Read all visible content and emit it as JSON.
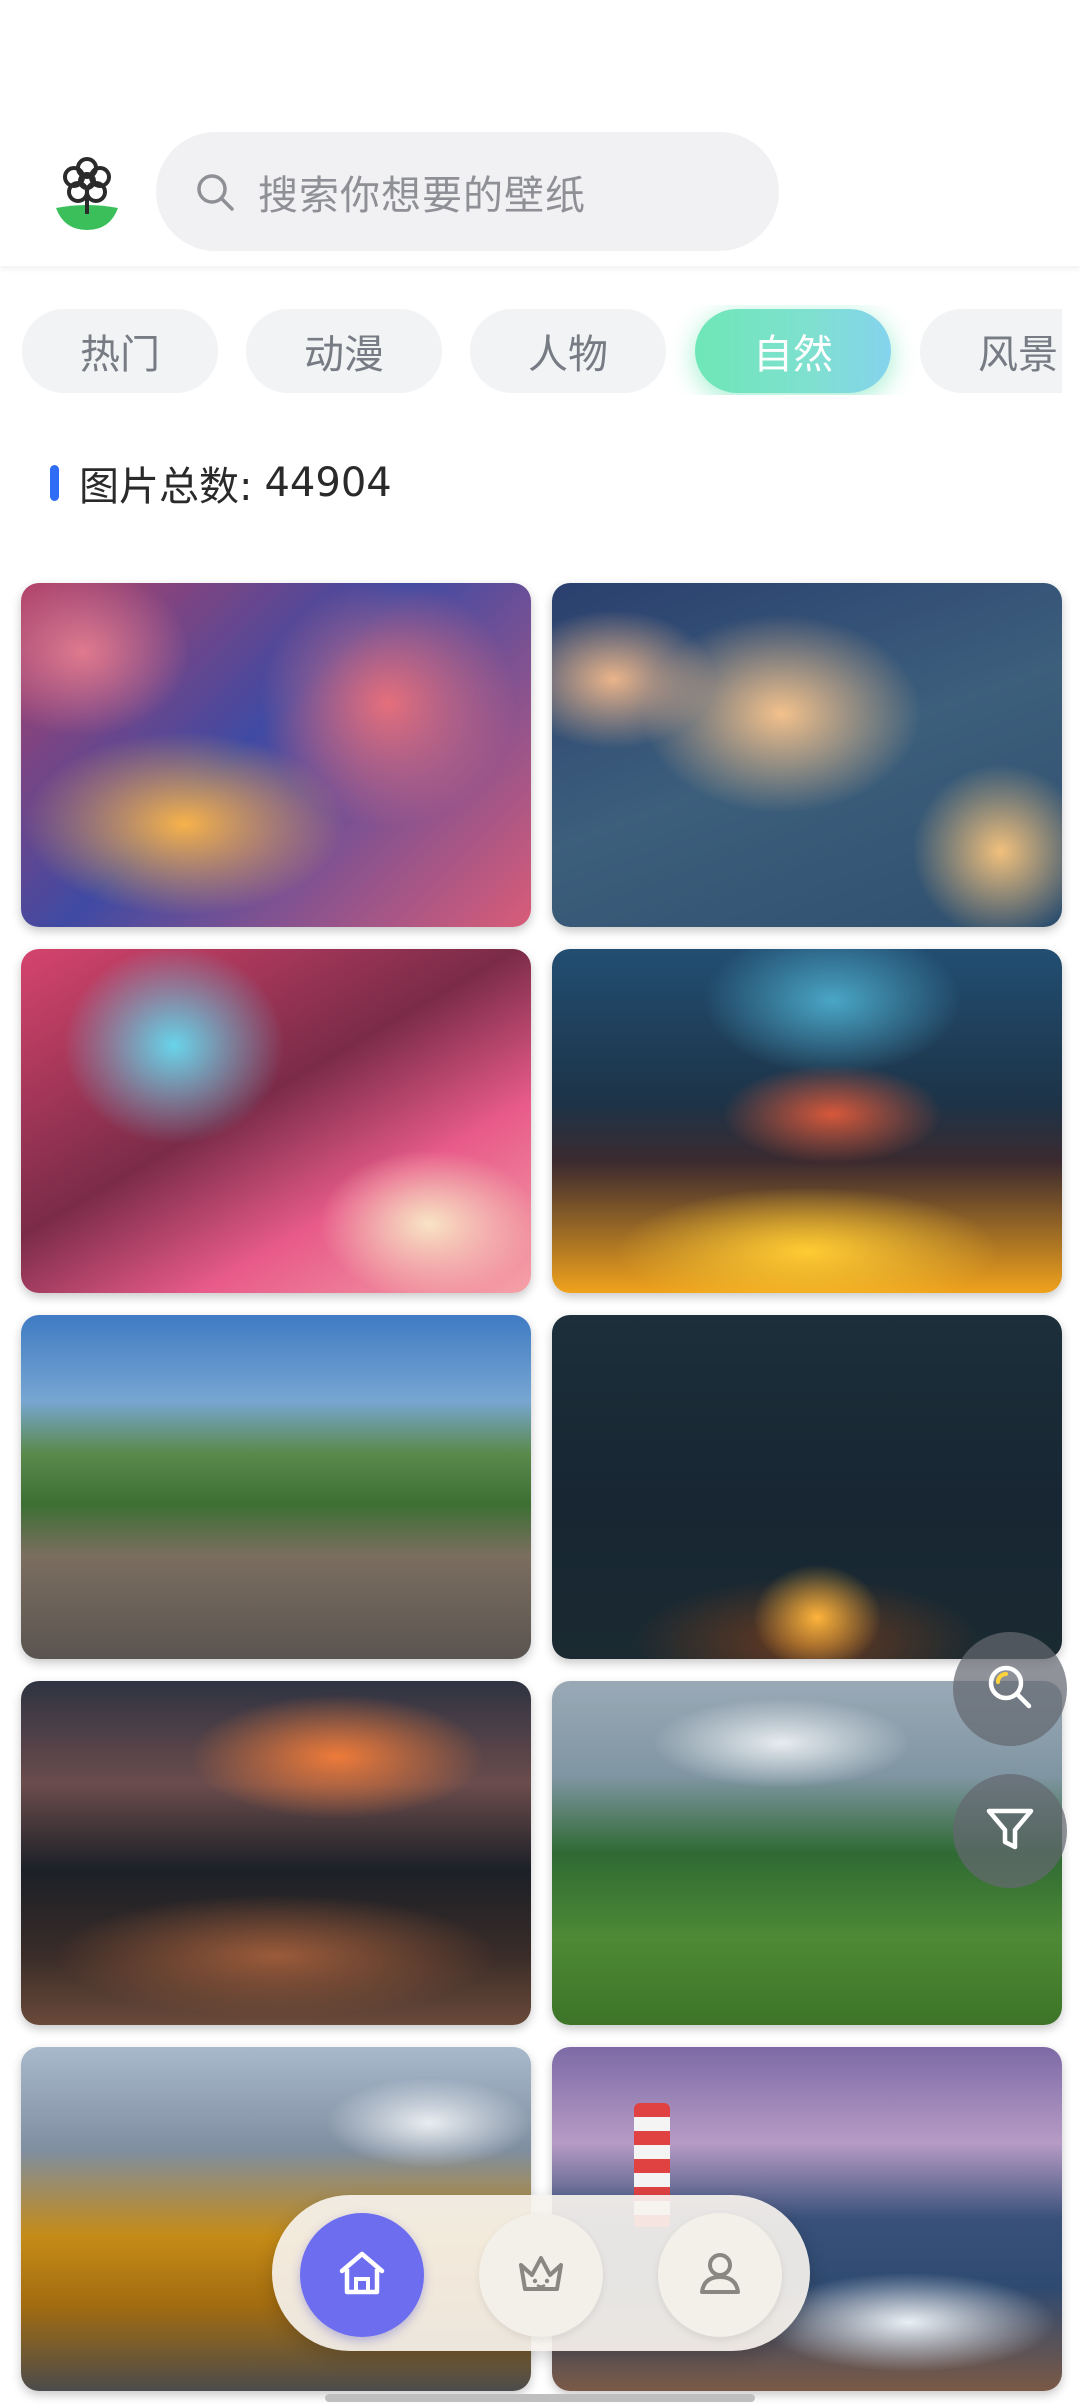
{
  "search": {
    "placeholder": "搜索你想要的壁纸"
  },
  "tabs": [
    {
      "label": "热门"
    },
    {
      "label": "动漫"
    },
    {
      "label": "人物"
    },
    {
      "label": "自然",
      "active": true
    },
    {
      "label": "风景"
    }
  ],
  "summary": {
    "label": "图片总数:",
    "count": "44904"
  },
  "wallpapers": [
    {
      "subject": "pink-orange painted clouds"
    },
    {
      "subject": "golden clouds on blue sky"
    },
    {
      "subject": "magenta cloud arch"
    },
    {
      "subject": "sunset storm clouds over yellow horizon"
    },
    {
      "subject": "mountain village cemetery"
    },
    {
      "subject": "campfire in dark forest"
    },
    {
      "subject": "volcano at dusk with pine forest"
    },
    {
      "subject": "butterfly over green mountain meadow"
    },
    {
      "subject": "autumn road to snowy mountains"
    },
    {
      "subject": "striped lighthouse by the sea"
    }
  ],
  "colors": {
    "accent_blue": "#2f6df6",
    "active_tab_start": "#6ee7b7",
    "active_tab_end": "#85d3ee",
    "home_button": "#6d6df0"
  },
  "icons": [
    "flower-logo-icon",
    "search-icon",
    "magnifier-icon",
    "filter-icon",
    "home-icon",
    "crown-icon",
    "user-icon"
  ]
}
